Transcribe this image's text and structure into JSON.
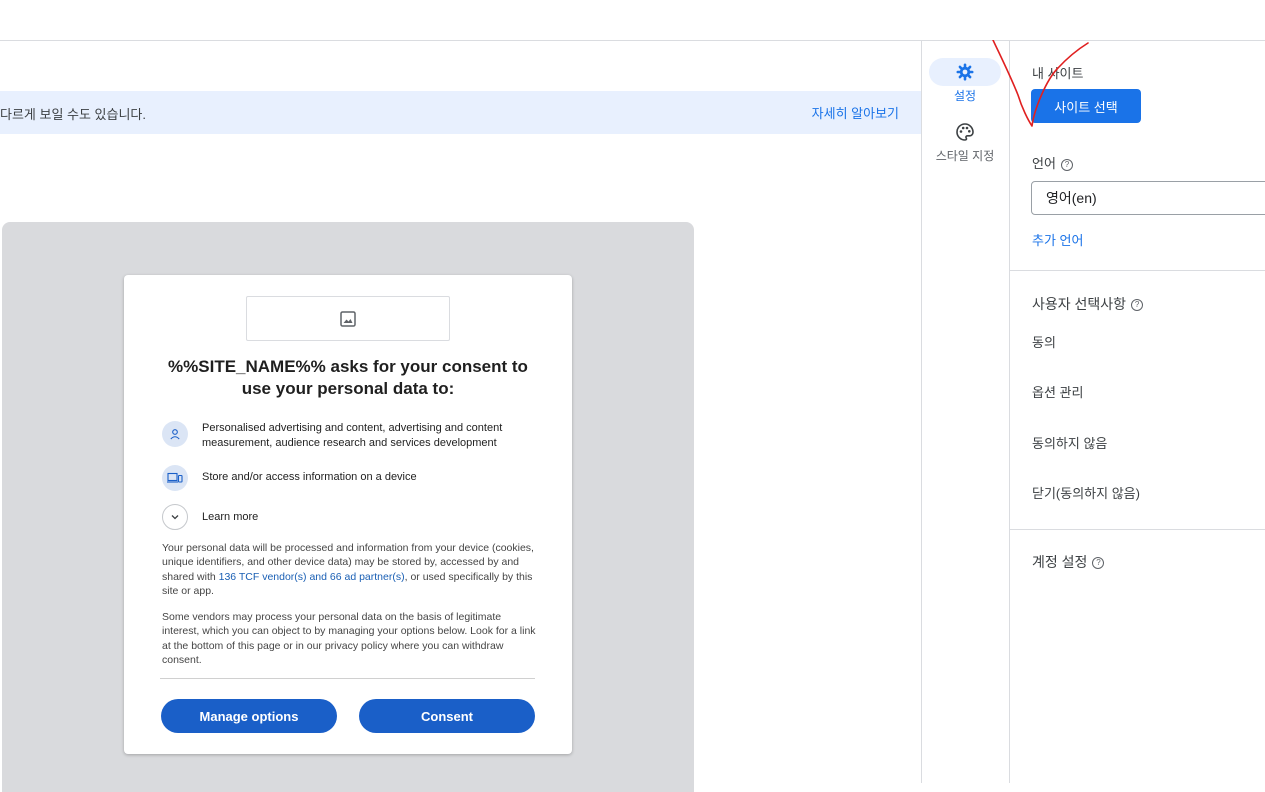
{
  "banner": {
    "text": "다르게 보일 수도 있습니다.",
    "link": "자세히 알아보기"
  },
  "consent_card": {
    "title": "%%SITE_NAME%% asks for your consent to use your personal data to:",
    "purposes": [
      {
        "icon": "person-icon",
        "text": "Personalised advertising and content, advertising and content measurement, audience research and services development"
      },
      {
        "icon": "device-icon",
        "text": "Store and/or access information on a device"
      },
      {
        "icon": "chevron-down-icon",
        "text": "Learn more"
      }
    ],
    "paragraph1_before": "Your personal data will be processed and information from your device (cookies, unique identifiers, and other device data) may be stored by, accessed by and shared with ",
    "paragraph1_link": "136 TCF vendor(s) and 66 ad partner(s)",
    "paragraph1_after": ", or used specifically by this site or app.",
    "paragraph2": "Some vendors may process your personal data on the basis of legitimate interest, which you can object to by managing your options below. Look for a link at the bottom of this page or in our privacy policy where you can withdraw consent.",
    "manage_button": "Manage options",
    "consent_button": "Consent"
  },
  "side_tabs": [
    {
      "icon": "gear-icon",
      "label": "설정",
      "active": true
    },
    {
      "icon": "palette-icon",
      "label": "스타일 지정",
      "active": false
    }
  ],
  "right_panel": {
    "my_site_label": "내 사이트",
    "select_site_button": "사이트 선택",
    "language_label": "언어",
    "language_value": "영어(en)",
    "add_language_link": "추가 언어",
    "user_choices_label": "사용자 선택사항",
    "choices": [
      "동의",
      "옵션 관리",
      "동의하지 않음",
      "닫기(동의하지 않음)"
    ],
    "account_settings_label": "계정 설정"
  },
  "colors": {
    "accent": "#1a73e8",
    "consent_button": "#1a5fc8",
    "banner_bg": "#e8f0fe",
    "preview_bg": "#d9dadd",
    "annotation_mark": "#e02020"
  }
}
